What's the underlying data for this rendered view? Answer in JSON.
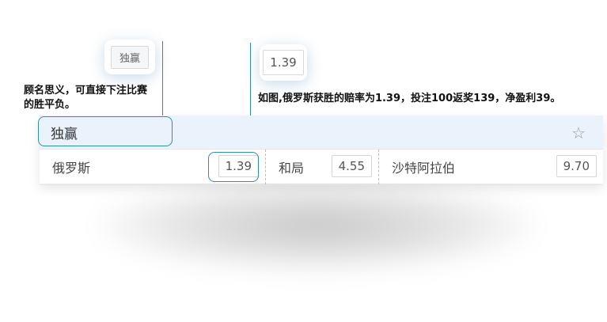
{
  "callouts": {
    "market_name_chip": "独赢",
    "odds_chip": "1.39"
  },
  "notes": {
    "left_note_line1": "顾名思义，可直接下注比赛",
    "left_note_line2": "的胜平负。",
    "right_note": "如图,俄罗斯获胜的赔率为1.39，投注100返奖139，净盈利39。"
  },
  "market": {
    "title": "独赢",
    "favorite_icon": "star-outline-icon",
    "outcomes": [
      {
        "name": "俄罗斯",
        "odds": "1.39"
      },
      {
        "name": "和局",
        "odds": "4.55"
      },
      {
        "name": "沙特阿拉伯",
        "odds": "9.70"
      }
    ]
  },
  "colors": {
    "accent": "#2f8fa6",
    "header_bg": "#eaf3fb"
  }
}
